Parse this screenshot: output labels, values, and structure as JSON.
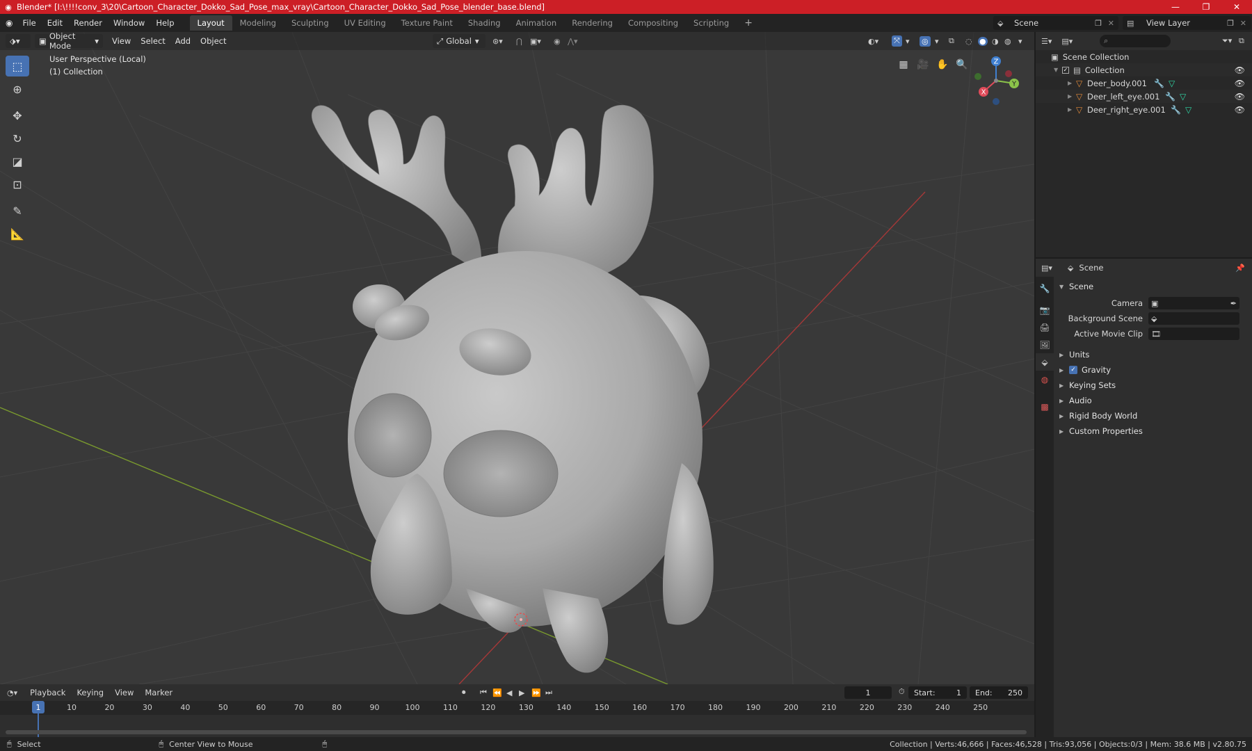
{
  "window": {
    "title": "Blender* [I:\\!!!!conv_3\\20\\Cartoon_Character_Dokko_Sad_Pose_max_vray\\Cartoon_Character_Dokko_Sad_Pose_blender_base.blend]",
    "minimize": "—",
    "restore": "❐",
    "close": "✕"
  },
  "menubar": {
    "items": [
      "File",
      "Edit",
      "Render",
      "Window",
      "Help"
    ]
  },
  "workspaces": {
    "tabs": [
      "Layout",
      "Modeling",
      "Sculpting",
      "UV Editing",
      "Texture Paint",
      "Shading",
      "Animation",
      "Rendering",
      "Compositing",
      "Scripting"
    ],
    "active": "Layout",
    "add": "+"
  },
  "scene_selector": {
    "value": "Scene"
  },
  "view_layer_selector": {
    "value": "View Layer"
  },
  "viewport": {
    "mode": "Object Mode",
    "menus": [
      "View",
      "Select",
      "Add",
      "Object"
    ],
    "transform_orientation": "Global",
    "overlay_line1": "User Perspective (Local)",
    "overlay_line2": "(1) Collection",
    "gizmo": {
      "x": "X",
      "y": "Y",
      "z": "Z"
    }
  },
  "outliner": {
    "search_placeholder": "",
    "root": "Scene Collection",
    "collection": "Collection",
    "objects": [
      "Deer_body.001",
      "Deer_left_eye.001",
      "Deer_right_eye.001"
    ]
  },
  "properties": {
    "header_title": "Scene",
    "panel_scene": "Scene",
    "fields": [
      {
        "label": "Camera",
        "value": ""
      },
      {
        "label": "Background Scene",
        "value": ""
      },
      {
        "label": "Active Movie Clip",
        "value": ""
      }
    ],
    "panels": [
      "Units",
      "Gravity",
      "Keying Sets",
      "Audio",
      "Rigid Body World",
      "Custom Properties"
    ]
  },
  "timeline": {
    "menus": [
      "Playback",
      "Keying",
      "View",
      "Marker"
    ],
    "current_frame": "1",
    "start_label": "Start:",
    "start": "1",
    "end_label": "End:",
    "end": "250",
    "ticks": [
      "1",
      "10",
      "20",
      "30",
      "40",
      "50",
      "60",
      "70",
      "80",
      "90",
      "100",
      "110",
      "120",
      "130",
      "140",
      "150",
      "160",
      "170",
      "180",
      "190",
      "200",
      "210",
      "220",
      "230",
      "240",
      "250"
    ]
  },
  "statusbar": {
    "left_action": "Select",
    "middle_action": "Center View to Mouse",
    "stats": "Collection | Verts:46,666 | Faces:46,528 | Tris:93,056 | Objects:0/3 | Mem: 38.6 MB | v2.80.75"
  },
  "colors": {
    "title_bar": "#cc1f26",
    "accent": "#4772b3",
    "object_icon": "#e0893a",
    "modifier_icon": "#6ea3ff",
    "mesh_icon": "#2fd8a6"
  }
}
